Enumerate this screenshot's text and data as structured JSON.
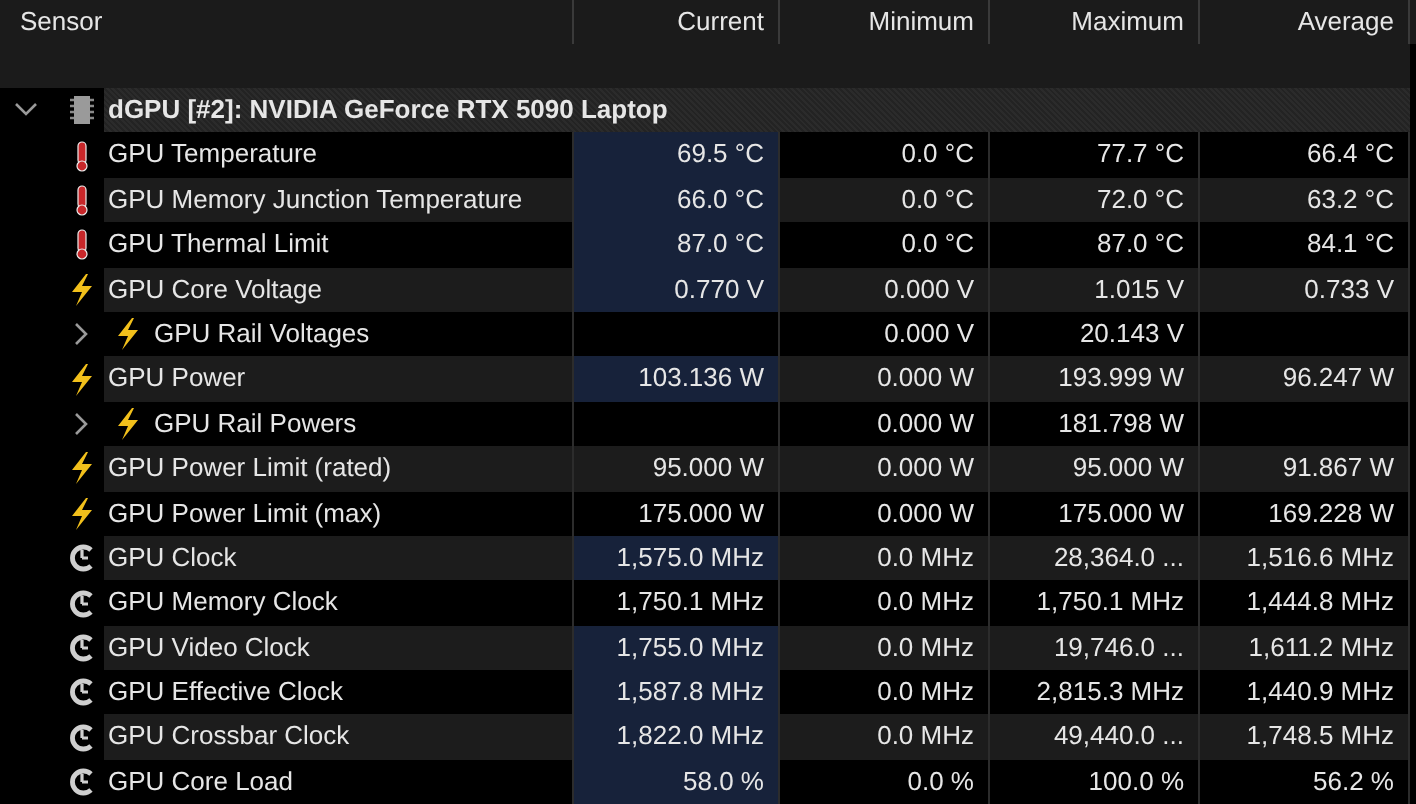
{
  "columns": [
    "Sensor",
    "Current",
    "Minimum",
    "Maximum",
    "Average"
  ],
  "sensors": [
    {
      "name": "dGPU [#2]: NVIDIA GeForce RTX 5090 Laptop",
      "kind": "device",
      "expanded": true,
      "children": [
        {
          "name": "GPU Temperature",
          "kind": "temperature",
          "highlighted": true,
          "current": "69.5 °C",
          "minimum": "0.0 °C",
          "maximum": "77.7 °C",
          "average": "66.4 °C"
        },
        {
          "name": "GPU Memory Junction Temperature",
          "kind": "temperature",
          "highlighted": true,
          "current": "66.0 °C",
          "minimum": "0.0 °C",
          "maximum": "72.0 °C",
          "average": "63.2 °C"
        },
        {
          "name": "GPU Thermal Limit",
          "kind": "temperature",
          "highlighted": true,
          "current": "87.0 °C",
          "minimum": "0.0 °C",
          "maximum": "87.0 °C",
          "average": "84.1 °C"
        },
        {
          "name": "GPU Core Voltage",
          "kind": "power",
          "highlighted": true,
          "current": "0.770 V",
          "minimum": "0.000 V",
          "maximum": "1.015 V",
          "average": "0.733 V"
        },
        {
          "name": "GPU Rail Voltages",
          "kind": "power",
          "expanded": false,
          "highlighted": false,
          "minimum": "0.000 V",
          "maximum": "20.143 V"
        },
        {
          "name": "GPU Power",
          "kind": "power",
          "highlighted": true,
          "current": "103.136 W",
          "minimum": "0.000 W",
          "maximum": "193.999 W",
          "average": "96.247 W"
        },
        {
          "name": "GPU Rail Powers",
          "kind": "power",
          "expanded": false,
          "highlighted": false,
          "minimum": "0.000 W",
          "maximum": "181.798 W"
        },
        {
          "name": "GPU Power Limit (rated)",
          "kind": "power",
          "highlighted": false,
          "current": "95.000 W",
          "minimum": "0.000 W",
          "maximum": "95.000 W",
          "average": "91.867 W"
        },
        {
          "name": "GPU Power Limit (max)",
          "kind": "power",
          "highlighted": false,
          "current": "175.000 W",
          "minimum": "0.000 W",
          "maximum": "175.000 W",
          "average": "169.228 W"
        },
        {
          "name": "GPU Clock",
          "kind": "clock",
          "highlighted": true,
          "current": "1,575.0 MHz",
          "minimum": "0.0 MHz",
          "maximum": "28,364.0 ...",
          "average": "1,516.6 MHz"
        },
        {
          "name": "GPU Memory Clock",
          "kind": "clock",
          "highlighted": false,
          "current": "1,750.1 MHz",
          "minimum": "0.0 MHz",
          "maximum": "1,750.1 MHz",
          "average": "1,444.8 MHz"
        },
        {
          "name": "GPU Video Clock",
          "kind": "clock",
          "highlighted": true,
          "current": "1,755.0 MHz",
          "minimum": "0.0 MHz",
          "maximum": "19,746.0 ...",
          "average": "1,611.2 MHz"
        },
        {
          "name": "GPU Effective Clock",
          "kind": "clock",
          "highlighted": true,
          "current": "1,587.8 MHz",
          "minimum": "0.0 MHz",
          "maximum": "2,815.3 MHz",
          "average": "1,440.9 MHz"
        },
        {
          "name": "GPU Crossbar Clock",
          "kind": "clock",
          "highlighted": true,
          "current": "1,822.0 MHz",
          "minimum": "0.0 MHz",
          "maximum": "49,440.0 ...",
          "average": "1,748.5 MHz"
        },
        {
          "name": "GPU Core Load",
          "kind": "clock",
          "highlighted": true,
          "current": "58.0 %",
          "minimum": "0.0 %",
          "maximum": "100.0 %",
          "average": "56.2 %"
        }
      ]
    }
  ]
}
